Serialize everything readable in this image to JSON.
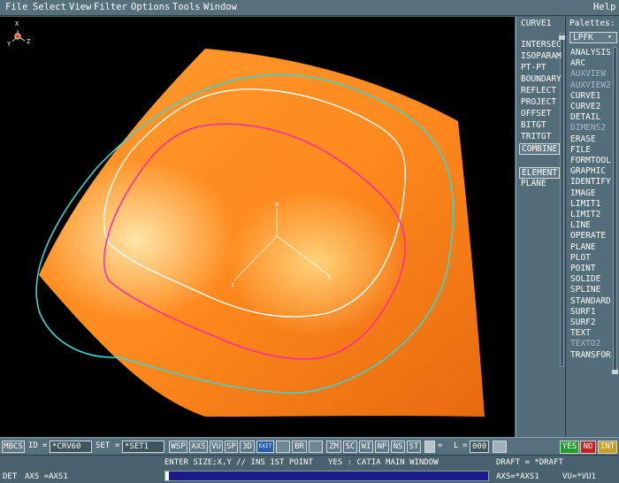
{
  "menu": {
    "items": [
      "File",
      "Select",
      "View",
      "Filter",
      "Options",
      "Tools",
      "Window"
    ],
    "help": "Help"
  },
  "viewport": {
    "axis_labels": {
      "x": "X",
      "y": "Y",
      "z": "Z"
    },
    "colors": {
      "surface": "#ff8a1e",
      "curve_cyan": "#39d6d2",
      "curve_white": "#ffffff",
      "curve_magenta": "#ff2aa0",
      "background": "#000000"
    }
  },
  "mid_panel": {
    "title": "CURVE1",
    "items": [
      {
        "label": "INTERSEC",
        "style": "normal"
      },
      {
        "label": "ISOPARAM",
        "style": "normal"
      },
      {
        "label": "PT-PT",
        "style": "normal"
      },
      {
        "label": "BOUNDARY",
        "style": "normal"
      },
      {
        "label": "REFLECT",
        "style": "normal"
      },
      {
        "label": "PROJECT",
        "style": "normal"
      },
      {
        "label": "OFFSET",
        "style": "normal"
      },
      {
        "label": "BITGT",
        "style": "normal"
      },
      {
        "label": "TRITGT",
        "style": "normal"
      },
      {
        "label": "COMBINE",
        "style": "boxed"
      },
      {
        "label": "ELEMENT",
        "style": "boxed"
      },
      {
        "label": "PLANE",
        "style": "normal"
      }
    ]
  },
  "right_panel": {
    "title": "Palettes:",
    "selector": "LPFK",
    "items": [
      {
        "label": "ANALYSIS",
        "dim": false
      },
      {
        "label": "ARC",
        "dim": false
      },
      {
        "label": "AUXVIEW",
        "dim": true
      },
      {
        "label": "AUXVIEW2",
        "dim": true
      },
      {
        "label": "CURVE1",
        "dim": false
      },
      {
        "label": "CURVE2",
        "dim": false
      },
      {
        "label": "DETAIL",
        "dim": false
      },
      {
        "label": "DIMENS2",
        "dim": true
      },
      {
        "label": "ERASE",
        "dim": false
      },
      {
        "label": "FILE",
        "dim": false
      },
      {
        "label": "FORMTOOL",
        "dim": false
      },
      {
        "label": "GRAPHIC",
        "dim": false
      },
      {
        "label": "IDENTIFY",
        "dim": false
      },
      {
        "label": "IMAGE",
        "dim": false
      },
      {
        "label": "LIMIT1",
        "dim": false
      },
      {
        "label": "LIMIT2",
        "dim": false
      },
      {
        "label": "LINE",
        "dim": false
      },
      {
        "label": "OPERATE",
        "dim": false
      },
      {
        "label": "PLANE",
        "dim": false
      },
      {
        "label": "PLOT",
        "dim": false
      },
      {
        "label": "POINT",
        "dim": false
      },
      {
        "label": "SOLIDE",
        "dim": false
      },
      {
        "label": "SPLINE",
        "dim": false
      },
      {
        "label": "STANDARD",
        "dim": false
      },
      {
        "label": "SURF1",
        "dim": false
      },
      {
        "label": "SURF2",
        "dim": false
      },
      {
        "label": "TEXT",
        "dim": false
      },
      {
        "label": "TEXTO2",
        "dim": true
      },
      {
        "label": "TRANSFOR",
        "dim": false
      }
    ]
  },
  "toolbar": {
    "mbcs": "MBCS",
    "id_label": "ID",
    "id_value": "*CRV60",
    "set_label": "SET",
    "set_value": "*SET1",
    "buttons": [
      "WSP",
      "AXS",
      "VU",
      "SP",
      "3D"
    ],
    "exit": "EXIT",
    "buttons2": [
      "BR",
      "ZM",
      "SC",
      "WI",
      "NP",
      "NS",
      "ST"
    ],
    "l_label": "L",
    "l_value": "000",
    "yes": "YES",
    "no": "NO",
    "int": "INT",
    "yes_color": "#1f9e2b",
    "no_color": "#c92020",
    "int_color": "#c9a020"
  },
  "status": {
    "prompt": "ENTER SIZE;X,Y // INS 1ST POINT",
    "yes_msg": "YES : CATIA MAIN WINDOW",
    "draft": "DRAFT = *DRAFT",
    "det": "DET",
    "axs": "AXS =AXS1",
    "axs_right": "AXS=*AXS1",
    "vu": "VU=*VU1",
    "progress_pct": 1
  }
}
